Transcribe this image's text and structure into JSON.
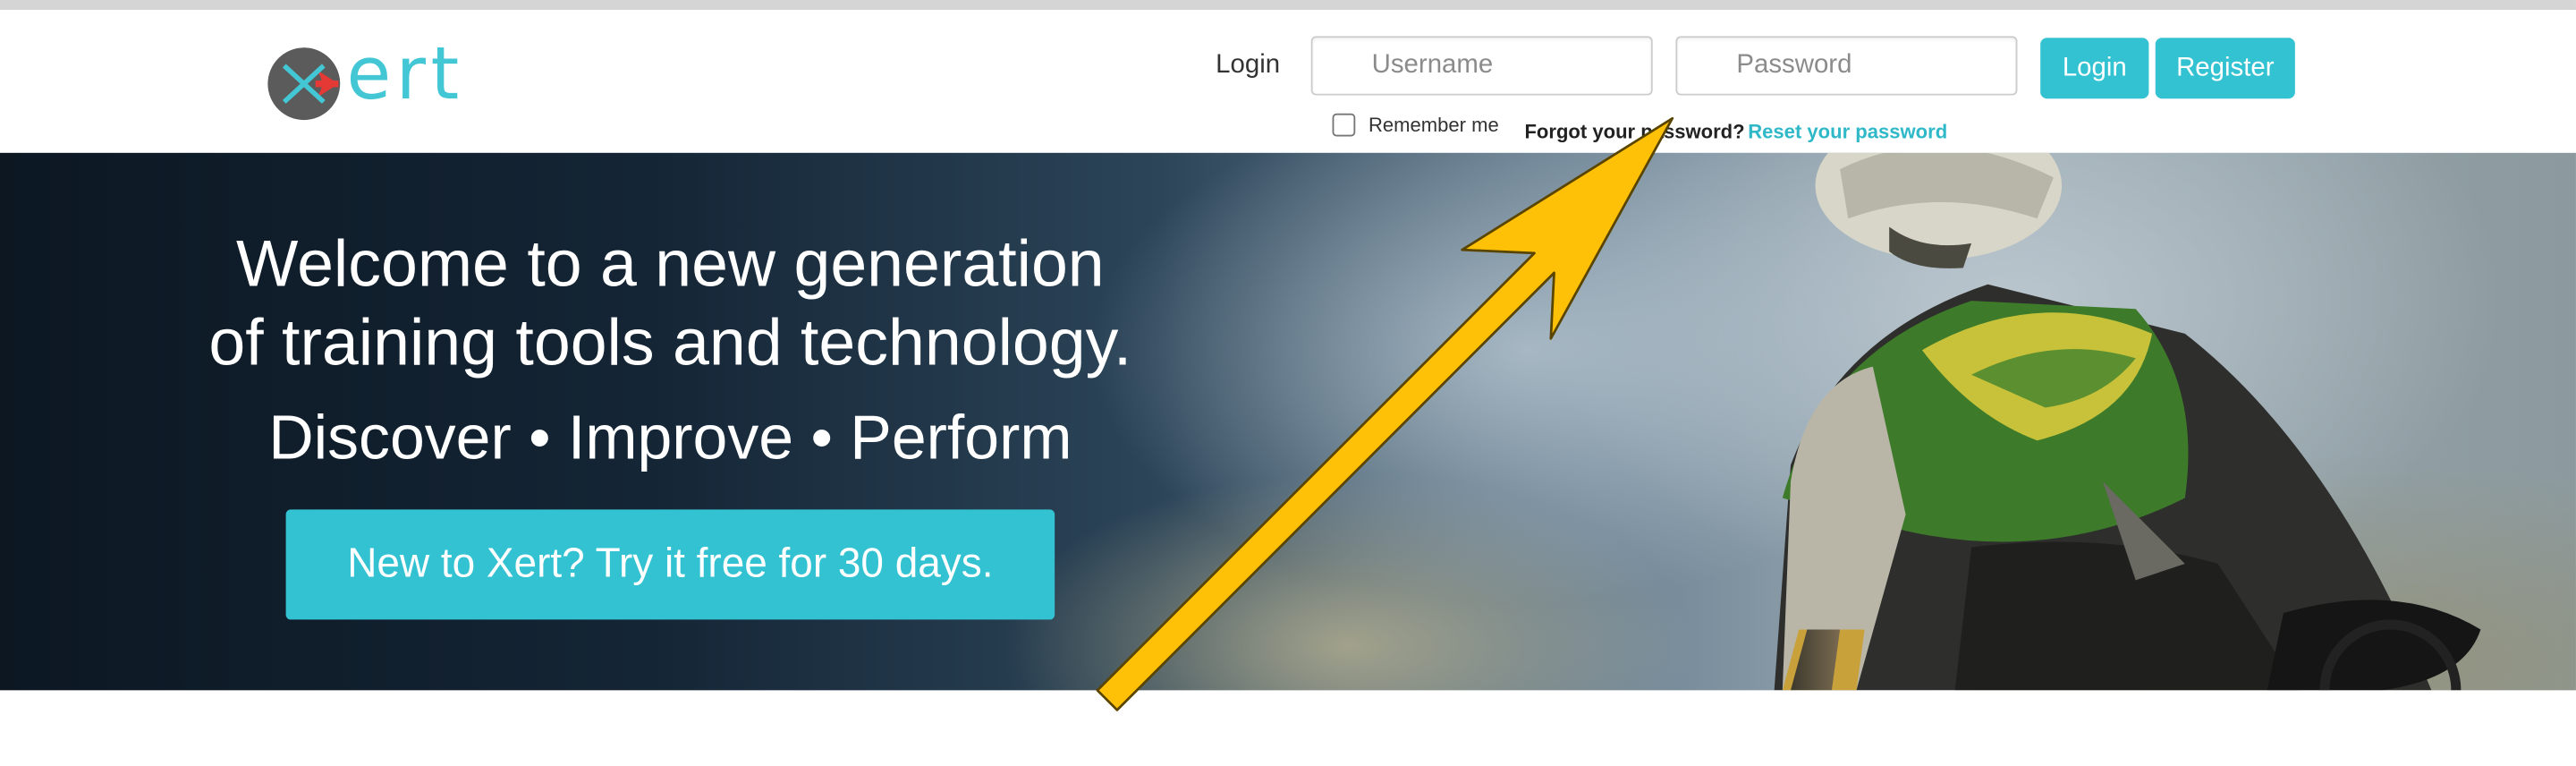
{
  "brand": {
    "logo_text": "ert",
    "accent": "#33c2d2",
    "logo_mark_color": "#e53935"
  },
  "header": {
    "login_label": "Login",
    "username_placeholder": "Username",
    "password_placeholder": "Password",
    "login_button": "Login",
    "register_button": "Register",
    "remember_me": "Remember me",
    "forgot_password": "Forgot your password?",
    "reset_password": "Reset your password"
  },
  "hero": {
    "title_line1": "Welcome to a new generation",
    "title_line2": "of training tools and technology.",
    "subtitle": "Discover • Improve • Perform",
    "cta": "New to Xert? Try it free for 30 days."
  },
  "annotation": {
    "arrow_color": "#ffc107",
    "arrow_icon": "yellow-arrow-icon"
  }
}
